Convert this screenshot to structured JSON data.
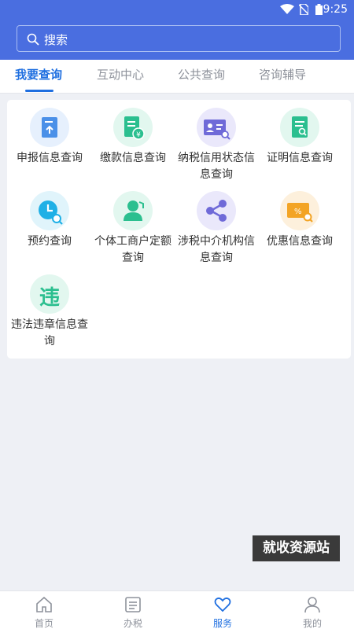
{
  "status_bar": {
    "time": "9:25"
  },
  "search": {
    "placeholder": "搜索"
  },
  "tabs": [
    {
      "label": "我要查询",
      "active": true
    },
    {
      "label": "互动中心",
      "active": false
    },
    {
      "label": "公共查询",
      "active": false
    },
    {
      "label": "咨询辅导",
      "active": false
    }
  ],
  "services": [
    {
      "label": "申报信息查询",
      "icon": "declaration-icon"
    },
    {
      "label": "缴款信息查询",
      "icon": "payment-icon"
    },
    {
      "label": "纳税信用状态信息查询",
      "icon": "credit-id-card-icon"
    },
    {
      "label": "证明信息查询",
      "icon": "certificate-icon"
    },
    {
      "label": "预约查询",
      "icon": "clock-icon"
    },
    {
      "label": "个体工商户定额查询",
      "icon": "person-icon"
    },
    {
      "label": "涉税中介机构信息查询",
      "icon": "share-icon"
    },
    {
      "label": "优惠信息查询",
      "icon": "discount-icon"
    },
    {
      "label": "违法违章信息查询",
      "icon": "violation-icon",
      "glyph": "违"
    }
  ],
  "watermark": "就收资源站",
  "bottom_nav": [
    {
      "label": "首页",
      "icon": "home-icon",
      "active": false
    },
    {
      "label": "办税",
      "icon": "list-icon",
      "active": false
    },
    {
      "label": "服务",
      "icon": "heart-icon",
      "active": true
    },
    {
      "label": "我的",
      "icon": "user-icon",
      "active": false
    }
  ],
  "colors": {
    "primary": "#4a6ee0",
    "accent": "#1f6fe0",
    "background": "#eef0f5"
  }
}
